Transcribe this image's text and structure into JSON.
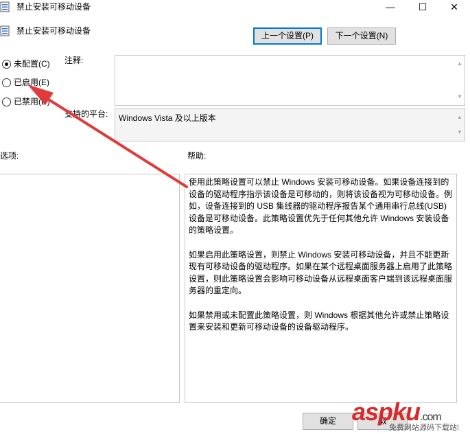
{
  "window": {
    "title": "禁止安装可移动设备",
    "minimize": "—",
    "maximize": "☐",
    "close": "✕"
  },
  "header": {
    "policy_name": "禁止安装可移动设备",
    "prev_button": "上一个设置(P)",
    "next_button": "下一个设置(N)"
  },
  "state": {
    "options": [
      {
        "label": "未配置(C)",
        "checked": true
      },
      {
        "label": "已启用(E)",
        "checked": false
      },
      {
        "label": "已禁用(D)",
        "checked": false
      }
    ]
  },
  "comment": {
    "label": "注释:",
    "value": ""
  },
  "platform": {
    "label": "支持的平台:",
    "value": "Windows Vista 及以上版本"
  },
  "options_section": {
    "label": "选项:"
  },
  "help_section": {
    "label": "帮助:",
    "paragraphs": [
      "使用此策略设置可以禁止 Windows 安装可移动设备。如果设备连接到的设备的驱动程序指示该设备是可移动的，则将该设备视为可移动设备。例如，设备连接到的 USB 集线器的驱动程序报告某个通用串行总线(USB)设备是可移动设备。此策略设置优先于任何其他允许 Windows 安装设备的策略设置。",
      "如果启用此策略设置，则禁止 Windows 安装可移动设备，并且不能更新现有可移动设备的驱动程序。如果在某个远程桌面服务器上启用了此策略设置，则此策略设置会影响可移动设备从远程桌面客户端到该远程桌面服务器的重定向。",
      "如果禁用或未配置此策略设置，则 Windows 根据其他允许或禁止策略设置来安装和更新可移动设备的设备驱动程序。"
    ]
  },
  "footer": {
    "ok_button": "确定",
    "cancel_button": "取"
  },
  "watermark": {
    "brand": "aspku",
    "domain": ".com",
    "tagline": "免费网站源码下载站!"
  },
  "colors": {
    "arrow": "#e03a3a",
    "primary_border": "#0078d7"
  }
}
